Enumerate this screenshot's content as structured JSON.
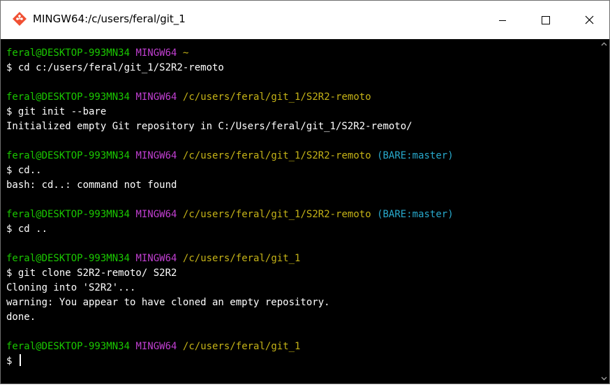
{
  "window": {
    "title": "MINGW64:/c/users/feral/git_1",
    "icon": "git-bash-icon"
  },
  "titlebar_buttons": {
    "minimize": "minimize-icon",
    "maximize": "maximize-icon",
    "close": "close-icon"
  },
  "colors": {
    "user_host": "#1ac900",
    "env": "#c13fd1",
    "path": "#c5b317",
    "branch": "#28a9cc",
    "background": "#000000",
    "text": "#ffffff"
  },
  "terminal": {
    "blocks": [
      {
        "prompt_user": "feral@DESKTOP-993MN34",
        "prompt_env": "MINGW64",
        "prompt_path": "~",
        "prompt_branch": "",
        "command": "$ cd c:/users/feral/git_1/S2R2-remoto",
        "output": []
      },
      {
        "prompt_user": "feral@DESKTOP-993MN34",
        "prompt_env": "MINGW64",
        "prompt_path": "/c/users/feral/git_1/S2R2-remoto",
        "prompt_branch": "",
        "command": "$ git init --bare",
        "output": [
          "Initialized empty Git repository in C:/Users/feral/git_1/S2R2-remoto/"
        ]
      },
      {
        "prompt_user": "feral@DESKTOP-993MN34",
        "prompt_env": "MINGW64",
        "prompt_path": "/c/users/feral/git_1/S2R2-remoto",
        "prompt_branch": "(BARE:master)",
        "command": "$ cd..",
        "output": [
          "bash: cd..: command not found"
        ]
      },
      {
        "prompt_user": "feral@DESKTOP-993MN34",
        "prompt_env": "MINGW64",
        "prompt_path": "/c/users/feral/git_1/S2R2-remoto",
        "prompt_branch": "(BARE:master)",
        "command": "$ cd ..",
        "output": []
      },
      {
        "prompt_user": "feral@DESKTOP-993MN34",
        "prompt_env": "MINGW64",
        "prompt_path": "/c/users/feral/git_1",
        "prompt_branch": "",
        "command": "$ git clone S2R2-remoto/ S2R2",
        "output": [
          "Cloning into 'S2R2'...",
          "warning: You appear to have cloned an empty repository.",
          "done."
        ]
      },
      {
        "prompt_user": "feral@DESKTOP-993MN34",
        "prompt_env": "MINGW64",
        "prompt_path": "/c/users/feral/git_1",
        "prompt_branch": "",
        "command": "$ ",
        "output": []
      }
    ]
  },
  "scrollbar": {
    "up": "scroll-up-arrow-icon",
    "down": "scroll-down-arrow-icon"
  }
}
